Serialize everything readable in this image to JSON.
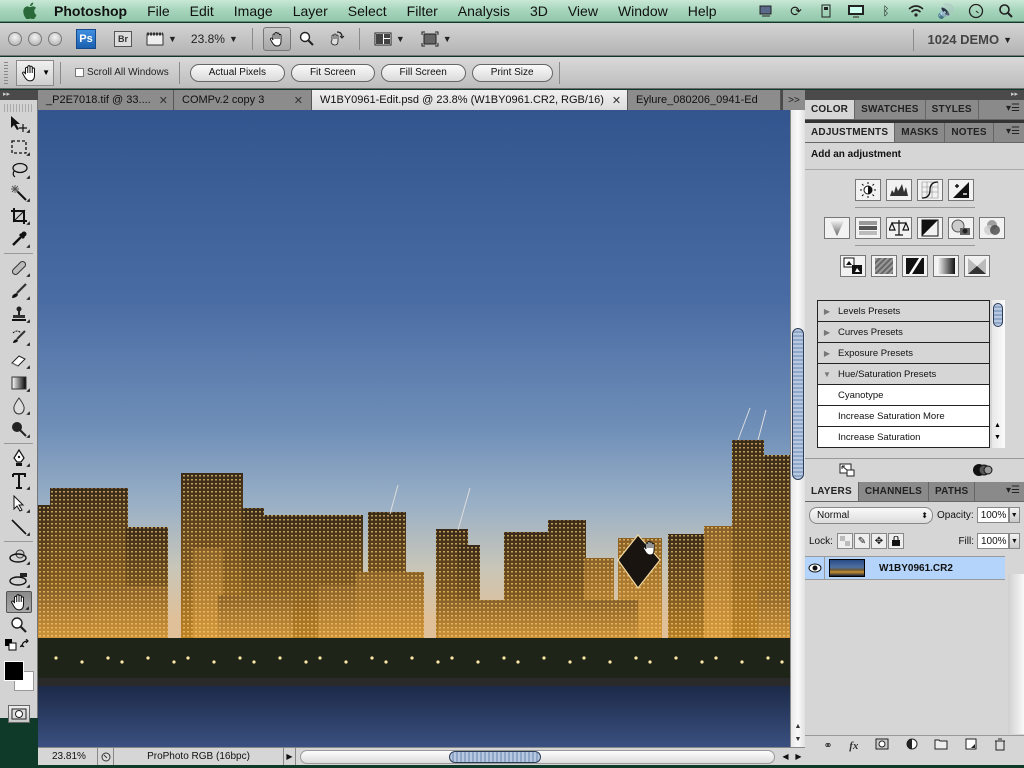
{
  "menubar": {
    "app_name": "Photoshop",
    "items": [
      "File",
      "Edit",
      "Image",
      "Layer",
      "Select",
      "Filter",
      "Analysis",
      "3D",
      "View",
      "Window",
      "Help"
    ],
    "tray_icons": [
      "screen-sharing-icon",
      "sync-icon",
      "disk-icon",
      "display-icon",
      "bluetooth-icon",
      "wifi-icon",
      "volume-icon",
      "clock-icon",
      "spotlight-search-icon"
    ]
  },
  "appbar": {
    "ps_badge": "Ps",
    "br_badge": "Br",
    "zoom_level": "23.8%",
    "workspace": "1024 DEMO"
  },
  "options": {
    "scroll_all_windows": "Scroll All Windows",
    "scroll_all_checked": false,
    "buttons": [
      "Actual Pixels",
      "Fit Screen",
      "Fill Screen",
      "Print Size"
    ]
  },
  "tabs": [
    {
      "label": "_P2E7018.tif @ 33....",
      "active": false
    },
    {
      "label": "COMPv.2  copy 3",
      "active": false
    },
    {
      "label": "W1BY0961-Edit.psd @ 23.8% (W1BY0961.CR2, RGB/16)",
      "active": true
    },
    {
      "label": "Eylure_080206_0941-Ed",
      "active": false
    }
  ],
  "tab_overflow": ">>",
  "status": {
    "zoom": "23.81%",
    "profile": "ProPhoto RGB (16bpc)"
  },
  "color_panel": {
    "tabs": [
      "COLOR",
      "SWATCHES",
      "STYLES"
    ],
    "active": "COLOR"
  },
  "adjustments_panel": {
    "tabs": [
      "ADJUSTMENTS",
      "MASKS",
      "NOTES"
    ],
    "active": "ADJUSTMENTS",
    "heading": "Add an adjustment",
    "row1": [
      "brightness-contrast-icon",
      "levels-icon",
      "curves-icon",
      "exposure-icon"
    ],
    "row2": [
      "vibrance-icon",
      "hue-saturation-icon",
      "color-balance-icon",
      "black-white-icon",
      "photo-filter-icon",
      "channel-mixer-icon"
    ],
    "row3": [
      "invert-icon",
      "posterize-icon",
      "threshold-icon",
      "gradient-map-icon",
      "selective-color-icon"
    ],
    "presets": [
      {
        "label": "Levels Presets",
        "type": "group",
        "expanded": false
      },
      {
        "label": "Curves Presets",
        "type": "group",
        "expanded": false
      },
      {
        "label": "Exposure Presets",
        "type": "group",
        "expanded": false
      },
      {
        "label": "Hue/Saturation Presets",
        "type": "group",
        "expanded": true
      },
      {
        "label": "Cyanotype",
        "type": "item"
      },
      {
        "label": "Increase Saturation More",
        "type": "item"
      },
      {
        "label": "Increase Saturation",
        "type": "item"
      }
    ]
  },
  "layers_panel": {
    "tabs": [
      "LAYERS",
      "CHANNELS",
      "PATHS"
    ],
    "active": "LAYERS",
    "blend_mode": "Normal",
    "opacity_label": "Opacity:",
    "opacity": "100%",
    "lock_label": "Lock:",
    "fill_label": "Fill:",
    "fill": "100%",
    "layers": [
      {
        "name": "W1BY0961.CR2",
        "visible": true,
        "selected": true
      }
    ]
  }
}
